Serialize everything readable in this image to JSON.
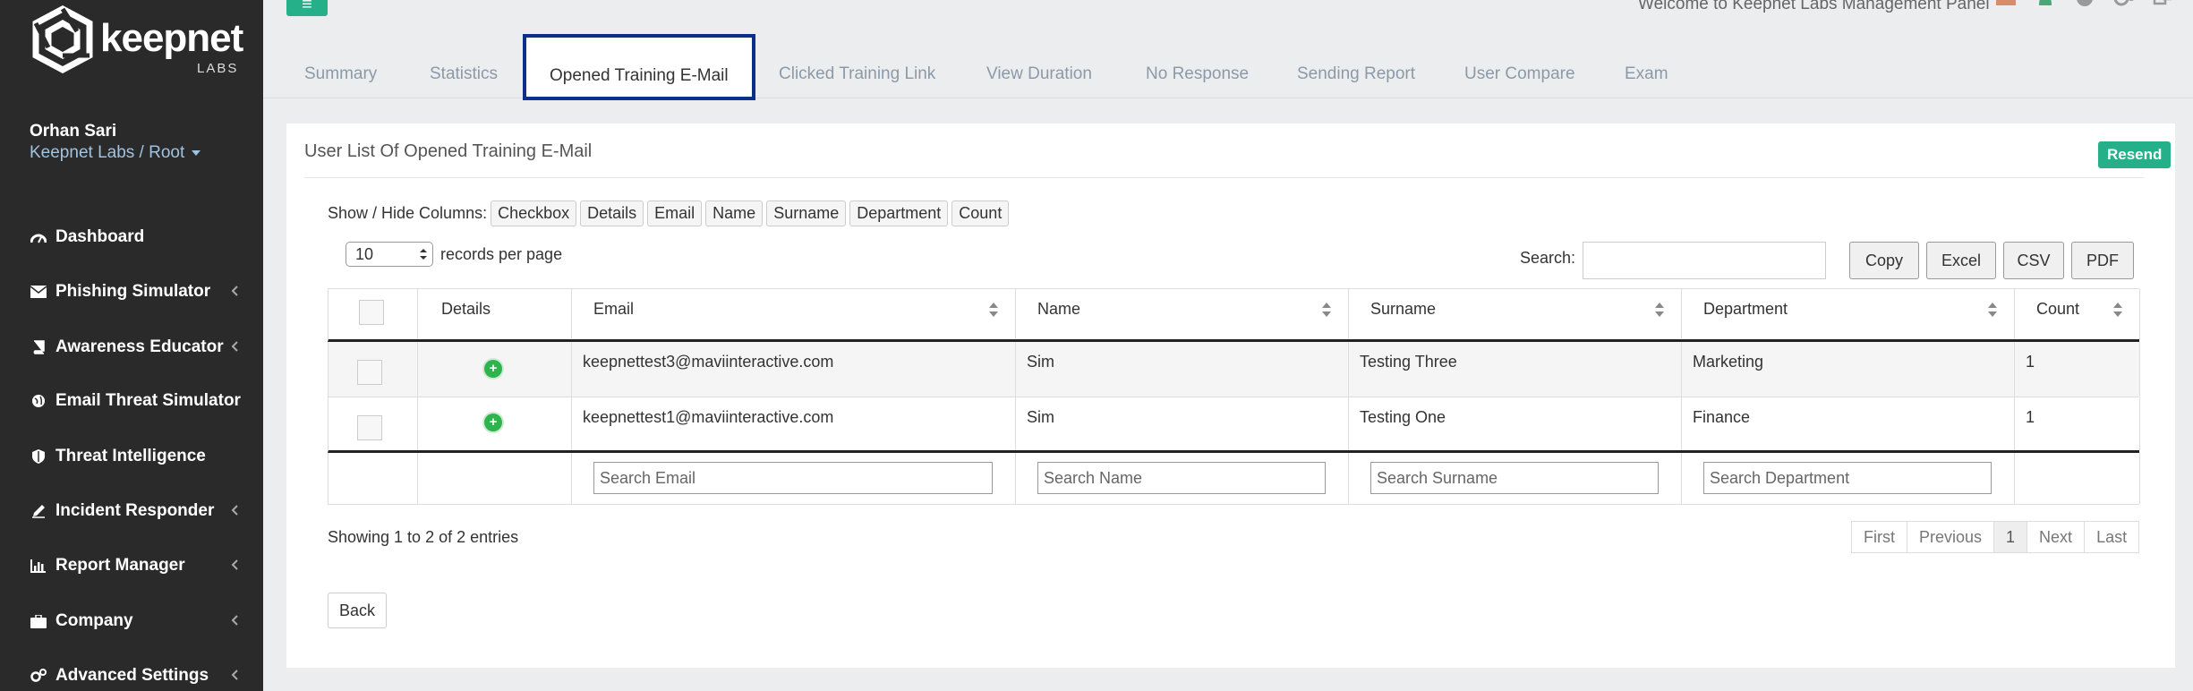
{
  "brand": {
    "word": "keepnet",
    "sub": "LABS"
  },
  "user": {
    "name": "Orhan Sari",
    "org": "Keepnet Labs / Root"
  },
  "nav": [
    {
      "label": "Dashboard",
      "icon": "dashboard-icon",
      "chevron": false
    },
    {
      "label": "Phishing Simulator",
      "icon": "envelope-icon",
      "chevron": true
    },
    {
      "label": "Awareness Educator",
      "icon": "book-icon",
      "chevron": true
    },
    {
      "label": "Email Threat Simulator",
      "icon": "globe-icon",
      "chevron": false
    },
    {
      "label": "Threat Intelligence",
      "icon": "shield-icon",
      "chevron": false
    },
    {
      "label": "Incident Responder",
      "icon": "pen-icon",
      "chevron": true
    },
    {
      "label": "Report Manager",
      "icon": "bar-chart-icon",
      "chevron": true
    },
    {
      "label": "Company",
      "icon": "briefcase-icon",
      "chevron": true
    },
    {
      "label": "Advanced Settings",
      "icon": "cogs-icon",
      "chevron": true
    }
  ],
  "topbar": {
    "welcome": "Welcome to Keepnet Labs Management Panel"
  },
  "tabs": [
    "Summary",
    "Statistics",
    "Opened Training E-Mail",
    "Clicked Training Link",
    "View Duration",
    "No Response",
    "Sending Report",
    "User Compare",
    "Exam"
  ],
  "panel": {
    "title": "User List Of Opened Training E-Mail",
    "resend": "Resend",
    "show_hide_label": "Show / Hide Columns:",
    "column_toggles": [
      "Checkbox",
      "Details",
      "Email",
      "Name",
      "Surname",
      "Department",
      "Count"
    ],
    "per_page_value": "10",
    "per_page_label": "records per page",
    "search_label": "Search:",
    "export_buttons": [
      "Copy",
      "Excel",
      "CSV",
      "PDF"
    ]
  },
  "table": {
    "headers": [
      "Details",
      "Email",
      "Name",
      "Surname",
      "Department",
      "Count"
    ],
    "rows": [
      {
        "email": "keepnettest3@maviinteractive.com",
        "name": "Sim",
        "surname": "Testing Three",
        "department": "Marketing",
        "count": "1"
      },
      {
        "email": "keepnettest1@maviinteractive.com",
        "name": "Sim",
        "surname": "Testing One",
        "department": "Finance",
        "count": "1"
      }
    ],
    "filters": [
      "Search Email",
      "Search Name",
      "Search Surname",
      "Search Department"
    ]
  },
  "footer": {
    "info": "Showing 1 to 2 of 2 entries",
    "pager": [
      "First",
      "Previous",
      "1",
      "Next",
      "Last"
    ],
    "back": "Back"
  },
  "colors": {
    "accent": "#26b08a",
    "sidebar": "#2a2a2a",
    "active_tab_border": "#0c2f8c"
  }
}
